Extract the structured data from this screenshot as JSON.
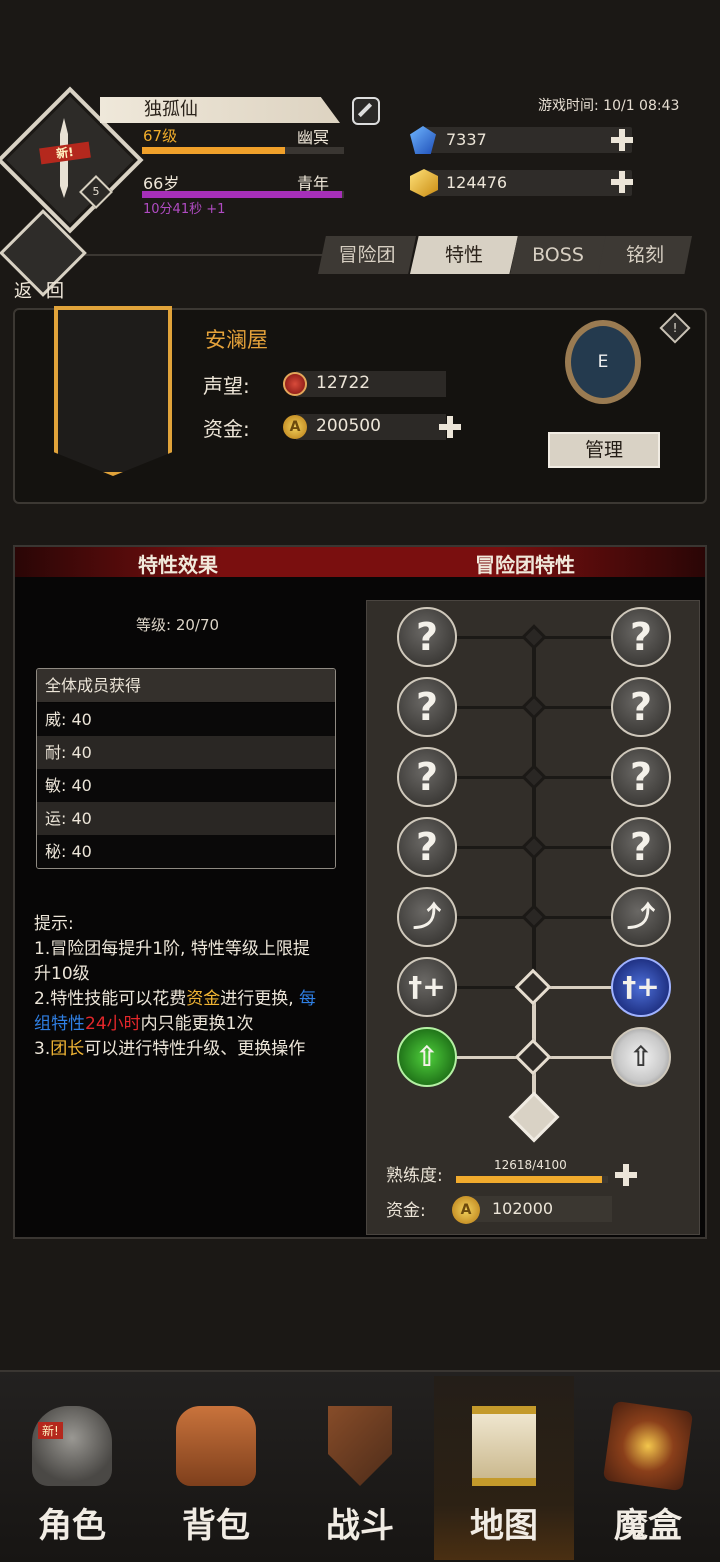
{
  "player": {
    "badge": "新!",
    "rank_number": "5",
    "name": "独孤仙",
    "level": "67级",
    "level_title": "幽冥",
    "level_progress": 0.71,
    "age": "66岁",
    "age_title": "青年",
    "age_progress": 0.99,
    "age_timer": "10分41秒 +1"
  },
  "game_time": "游戏时间: 10/1 08:43",
  "resources": {
    "gems": "7337",
    "gold": "124476"
  },
  "nav": {
    "back_label": "返回",
    "tabs": [
      "冒险团",
      "特性",
      "BOSS",
      "铭刻"
    ],
    "active_tab": 1
  },
  "guild": {
    "name": "安澜屋",
    "reputation_label": "声望:",
    "reputation": "12722",
    "funds_label": "资金:",
    "funds": "200500",
    "rank_letter": "E",
    "info": "!",
    "manage_label": "管理"
  },
  "traits": {
    "effect_header": "特性效果",
    "guild_header": "冒险团特性",
    "grade_text": "等级: 20/70",
    "table_title": "全体成员获得",
    "stats": [
      {
        "label": "威: 40"
      },
      {
        "label": "耐: 40"
      },
      {
        "label": "敏: 40"
      },
      {
        "label": "运: 40"
      },
      {
        "label": "秘: 40"
      }
    ],
    "tips": {
      "title": "提示:",
      "line1": "1.冒险团每提升1阶, 特性等级上限提升10级",
      "line2_a": "2.特性技能可以花费",
      "line2_b": "资金",
      "line2_c": "进行更换, ",
      "line2_d": "每组特性",
      "line2_e": "24小时",
      "line2_f": "内只能更换1次",
      "line3_a": "3.",
      "line3_b": "团长",
      "line3_c": "可以进行特性升级、更换操作"
    },
    "unknown_glyph": "?",
    "proficiency_label": "熟练度:",
    "proficiency": "12618/4100",
    "proficiency_progress": 0.96,
    "funds_label": "资金:",
    "funds": "102000"
  },
  "bottom_nav": [
    {
      "label": "角色",
      "icon": "helmet-icon"
    },
    {
      "label": "背包",
      "icon": "backpack-icon"
    },
    {
      "label": "战斗",
      "icon": "sword-shield-icon"
    },
    {
      "label": "地图",
      "icon": "scroll-map-icon"
    },
    {
      "label": "魔盒",
      "icon": "magic-box-icon"
    }
  ],
  "active_nav": 3
}
